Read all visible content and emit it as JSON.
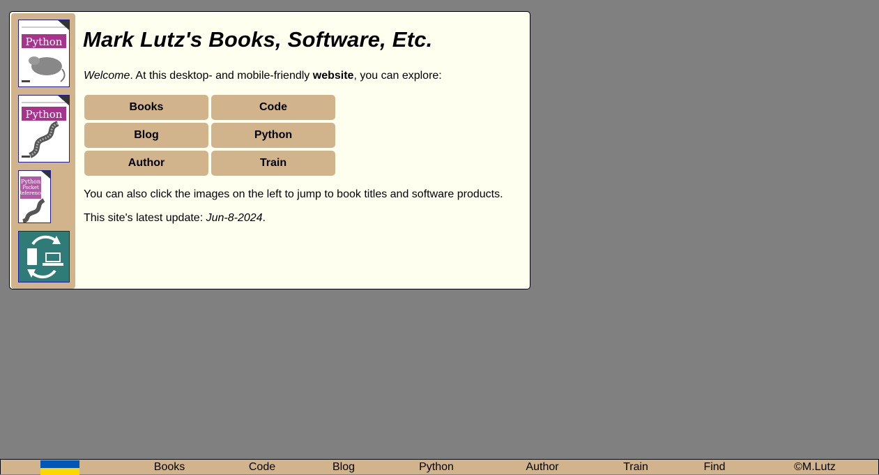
{
  "page": {
    "title": "Mark Lutz's Books, Software, Etc.",
    "welcome_italic": "Welcome",
    "welcome_after_italic": ". At this desktop- and mobile-friendly ",
    "welcome_bold": "website",
    "welcome_end": ", you can explore:",
    "line_images": "You can also click the images on the left to jump to book titles and software products.",
    "update_prefix": "This site's latest update: ",
    "update_date": "Jun-8-2024",
    "update_suffix": "."
  },
  "buttons": [
    "Books",
    "Code",
    "Blog",
    "Python",
    "Author",
    "Train"
  ],
  "sidebar": {
    "covers": [
      {
        "icon": "learning-python-book-cover",
        "cover_title": "Python"
      },
      {
        "icon": "programming-python-book-cover",
        "cover_title": "Python"
      },
      {
        "icon": "python-pocket-reference-book-cover",
        "cover_title": "Python Pocket Reference"
      },
      {
        "icon": "sync-devices-app-icon"
      }
    ]
  },
  "footer": {
    "items": [
      "Books",
      "Code",
      "Blog",
      "Python",
      "Author",
      "Train",
      "Find",
      "©M.Lutz"
    ],
    "flag": "ukraine-flag"
  },
  "colors": {
    "background": "#808080",
    "card": "#fffff0",
    "tan": "#d2b48c",
    "cover_magenta": "#a8338c",
    "app_teal": "#2e7b77",
    "flag_blue": "#0057b7",
    "flag_yellow": "#ffd700"
  }
}
